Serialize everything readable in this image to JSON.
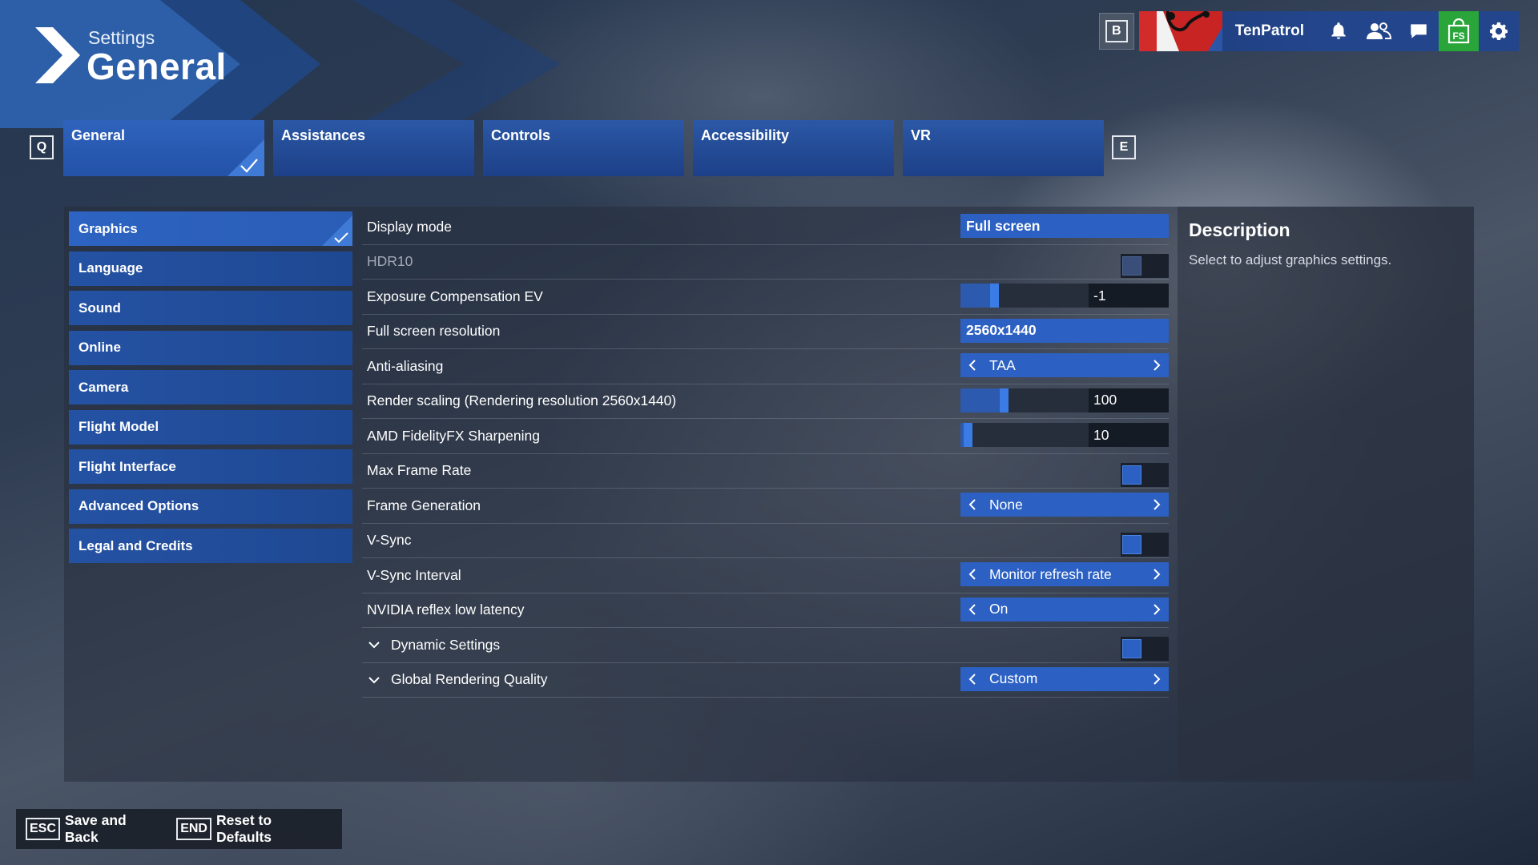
{
  "header": {
    "subtitle": "Settings",
    "title": "General"
  },
  "topbar": {
    "key": "B",
    "username": "TenPatrol",
    "store_label": "FS"
  },
  "tabs": {
    "prev_key": "Q",
    "next_key": "E",
    "items": [
      {
        "label": "General",
        "active": true
      },
      {
        "label": "Assistances",
        "active": false
      },
      {
        "label": "Controls",
        "active": false
      },
      {
        "label": "Accessibility",
        "active": false
      },
      {
        "label": "VR",
        "active": false
      }
    ]
  },
  "sidebar": {
    "items": [
      {
        "label": "Graphics",
        "active": true
      },
      {
        "label": "Language"
      },
      {
        "label": "Sound"
      },
      {
        "label": "Online"
      },
      {
        "label": "Camera"
      },
      {
        "label": "Flight Model"
      },
      {
        "label": "Flight Interface"
      },
      {
        "label": "Advanced Options"
      },
      {
        "label": "Legal and Credits"
      }
    ]
  },
  "settings": {
    "display_mode": {
      "label": "Display mode",
      "value": "Full screen"
    },
    "hdr10": {
      "label": "HDR10",
      "value": false
    },
    "exposure": {
      "label": "Exposure Compensation EV",
      "value": "-1",
      "fraction": 0.25
    },
    "resolution": {
      "label": "Full screen resolution",
      "value": "2560x1440"
    },
    "anti_aliasing": {
      "label": "Anti-aliasing",
      "value": "TAA"
    },
    "render_scaling": {
      "label": "Render scaling (Rendering resolution 2560x1440)",
      "value": "100",
      "fraction": 0.33
    },
    "sharpening": {
      "label": "AMD FidelityFX Sharpening",
      "value": "10",
      "fraction": 0.03
    },
    "max_frame_rate": {
      "label": "Max Frame Rate",
      "value": false
    },
    "frame_generation": {
      "label": "Frame Generation",
      "value": "None"
    },
    "vsync": {
      "label": "V-Sync",
      "value": false
    },
    "vsync_interval": {
      "label": "V-Sync Interval",
      "value": "Monitor refresh rate"
    },
    "nvidia_reflex": {
      "label": "NVIDIA reflex low latency",
      "value": "On"
    },
    "dynamic_settings": {
      "label": "Dynamic Settings",
      "value": false
    },
    "global_quality": {
      "label": "Global Rendering Quality",
      "value": "Custom"
    }
  },
  "description": {
    "title": "Description",
    "text": "Select to adjust graphics settings."
  },
  "bottom": {
    "save": {
      "key": "ESC",
      "label": "Save and Back"
    },
    "reset": {
      "key": "END",
      "label": "Reset to Defaults"
    }
  },
  "colors": {
    "accent": "#2c61c3",
    "accent_light": "#3f7ad6",
    "store_green": "#2aa53a"
  }
}
